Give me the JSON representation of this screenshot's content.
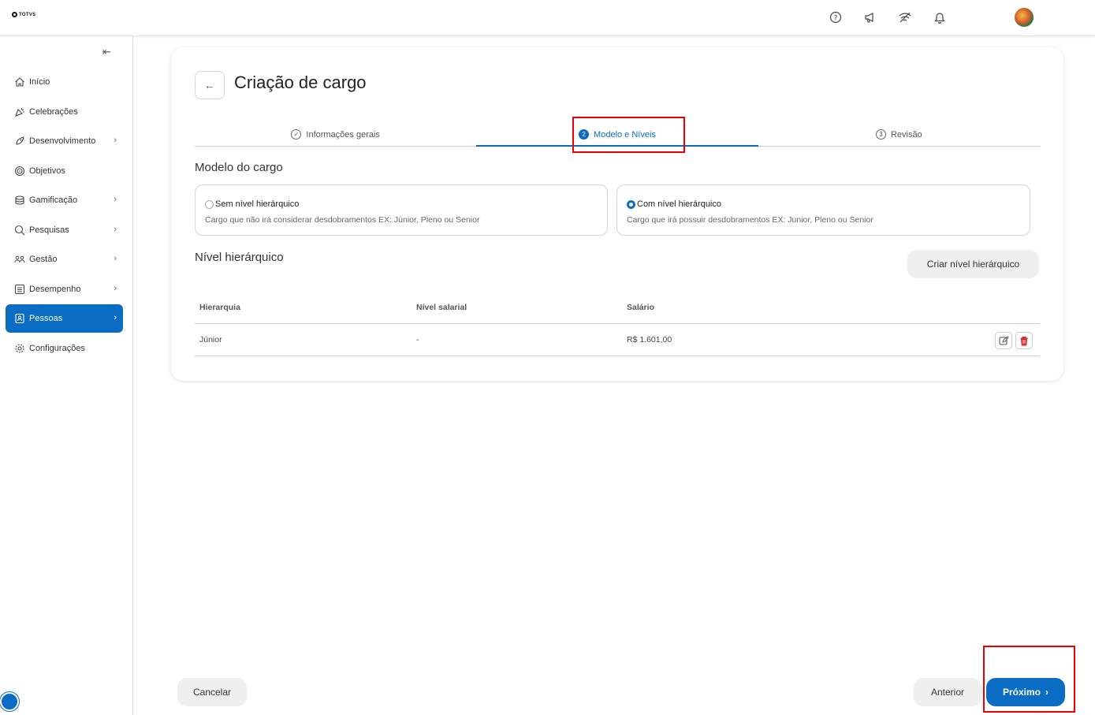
{
  "brand": {
    "logo_text": "TOTVS"
  },
  "topbar": {
    "icons": [
      "help-icon",
      "megaphone-icon",
      "signal-off-icon",
      "bell-icon"
    ],
    "avatar": "user-avatar"
  },
  "sidebar": {
    "collapse_icon": "⇤",
    "items": [
      {
        "label": "Início",
        "icon": "home-icon",
        "has_chevron": false
      },
      {
        "label": "Celebrações",
        "icon": "party-icon",
        "has_chevron": false
      },
      {
        "label": "Desenvolvimento",
        "icon": "rocket-icon",
        "has_chevron": true
      },
      {
        "label": "Objetivos",
        "icon": "target-icon",
        "has_chevron": false
      },
      {
        "label": "Gamificação",
        "icon": "coins-icon",
        "has_chevron": true
      },
      {
        "label": "Pesquisas",
        "icon": "search-survey-icon",
        "has_chevron": true
      },
      {
        "label": "Gestão",
        "icon": "people-icon",
        "has_chevron": true
      },
      {
        "label": "Desempenho",
        "icon": "list-icon",
        "has_chevron": true
      },
      {
        "label": "Pessoas",
        "icon": "badge-icon",
        "has_chevron": true,
        "active": true
      },
      {
        "label": "Configurações",
        "icon": "gear-icon",
        "has_chevron": false
      }
    ]
  },
  "page": {
    "title": "Criação de cargo",
    "steps": [
      {
        "num": "✓",
        "label": "Informações gerais",
        "state": "done"
      },
      {
        "num": "2",
        "label": "Modelo e Níveis",
        "state": "active"
      },
      {
        "num": "3",
        "label": "Revisão",
        "state": "pending"
      }
    ],
    "model_section_title": "Modelo do cargo",
    "options": [
      {
        "title": "Sem nível hierárquico",
        "desc": "Cargo que não irá considerar desdobramentos EX: Júnior, Pleno ou Senior",
        "selected": false
      },
      {
        "title": "Com nível hierárquico",
        "desc": "Cargo que irá possuir desdobramentos EX: Junior, Pleno ou Senior",
        "selected": true
      }
    ],
    "level_section_title": "Nível hierárquico",
    "create_level_button": "Criar nível hierárquico",
    "table": {
      "headers": [
        "Hierarquia",
        "Nível salarial",
        "Salário"
      ],
      "rows": [
        {
          "hierarquia": "Júnior",
          "nivel_salarial": "-",
          "salario": "R$ 1.601,00"
        }
      ]
    }
  },
  "footer": {
    "cancel": "Cancelar",
    "previous": "Anterior",
    "next": "Próximo"
  },
  "colors": {
    "accent": "#0b6cc4",
    "highlight": "#e00000",
    "danger": "#d32f2f"
  }
}
